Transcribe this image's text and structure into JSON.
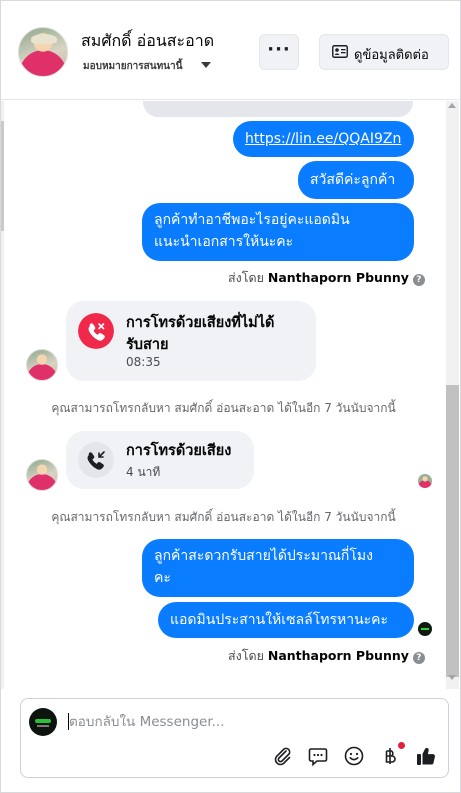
{
  "header": {
    "contact_name": "สมศักดิ์ อ่อนสะอาด",
    "assign_label": "มอบหมายการสนทนานี้",
    "more_label": "···",
    "info_button_label": "ดูข้อมูลติดต่อ"
  },
  "messages": {
    "link_text": "https://lin.ee/QQAI9Zn",
    "greeting": "สวัสดีค่ะลูกค้า",
    "question_line1": "ลูกค้าทำอาชีพอะไรอยู่คะแอดมิน",
    "question_line2": "แนะนำเอกสารให้นะคะ",
    "sent_by_prefix": "ส่งโดย",
    "sender_name": "Nanthaporn Pbunny",
    "help_glyph": "?",
    "missed_call_title_line1": "การโทรด้วยเสียงที่ไม่ได้",
    "missed_call_title_line2": "รับสาย",
    "missed_call_time": "08:35",
    "callback_note_1": "คุณสามารถโทรกลับหา สมศักดิ์ อ่อนสะอาด ได้ในอีก 7 วันนับจากนี้",
    "voice_call_title": "การโทรด้วยเสียง",
    "voice_call_duration": "4 นาที",
    "callback_note_2": "คุณสามารถโทรกลับหา สมศักดิ์ อ่อนสะอาด ได้ในอีก 7 วันนับจากนี้",
    "convenient_line1": "ลูกค้าสะดวกรับสายได้ประมาณกี่โมง",
    "convenient_line2": "คะ",
    "coordinate_msg": "แอดมินประสานให้เซลล์โทรหานะคะ"
  },
  "composer": {
    "placeholder": "ตอบกลับใน Messenger...",
    "value": ""
  },
  "colors": {
    "accent": "#0a7cff",
    "missed_call": "#f02849",
    "incoming_bg": "#f0f2f5"
  },
  "icons": [
    "more-icon",
    "contact-card-icon",
    "missed-call-icon",
    "incoming-call-icon",
    "attachment-icon",
    "saved-reply-icon",
    "emoji-icon",
    "baht-icon",
    "like-icon",
    "help-icon"
  ]
}
